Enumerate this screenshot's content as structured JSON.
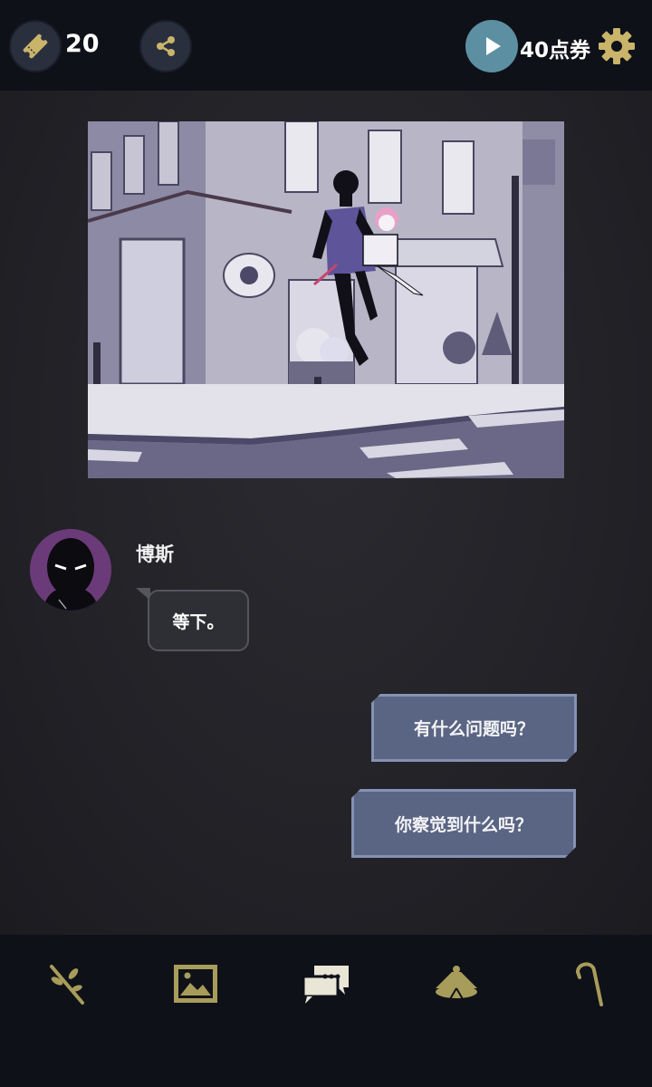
{
  "topbar": {
    "ticket_count": "20",
    "points_label": "40点券"
  },
  "dialogue": {
    "speaker": "博斯",
    "npc_line": "等下。",
    "choices": [
      "有什么问题吗？",
      "你察觉到什么吗？"
    ]
  },
  "bottom_nav": {
    "items": [
      "branch-icon",
      "gallery-icon",
      "chat-icon",
      "lamp-icon",
      "cane-icon"
    ],
    "active": "chat-icon"
  },
  "colors": {
    "accent_gold": "#c9b46a",
    "choice_fill": "#5a6483",
    "choice_border": "#8592b3",
    "play_button": "#5d8fa3"
  }
}
